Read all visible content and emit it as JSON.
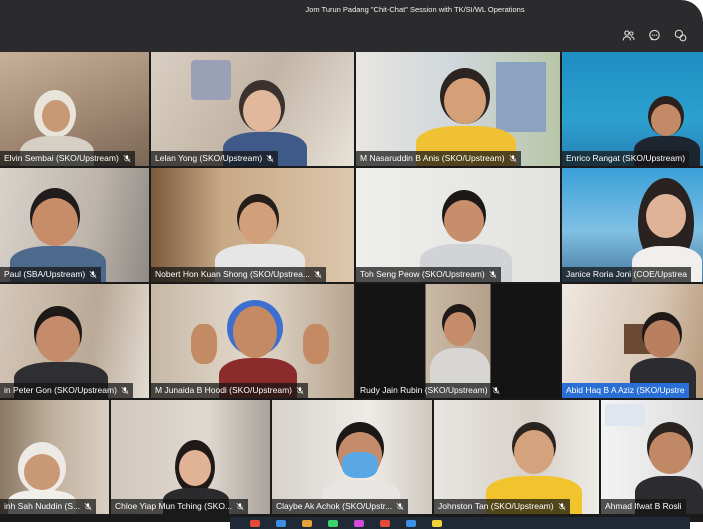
{
  "window": {
    "title": "Jom Turun Padang \"Chit-Chat\" Session with TK/SI/WL Operations"
  },
  "toolbar": {
    "icons": [
      "people-icon",
      "chat-icon",
      "reactions-icon",
      "more-icon"
    ]
  },
  "participants": [
    {
      "name": "Elvin Sembai (SKO/Upstream)",
      "row": 1
    },
    {
      "name": "Lelan Yong (SKO/Upstream)",
      "row": 1
    },
    {
      "name": "M Nasaruddin B Anis (SKO/Upstream)",
      "row": 1
    },
    {
      "name": "Enrico Rangat (SKO/Upstream)",
      "row": 1
    },
    {
      "name": "Paul (SBA/Upstream)",
      "row": 2
    },
    {
      "name": "Nobert Hon Kuan Shong (SKO/Upstrea...",
      "row": 2
    },
    {
      "name": "Toh Seng Peow (SKO/Upstream)",
      "row": 2
    },
    {
      "name": "Janice Roria Joni (COE/Upstrea",
      "row": 2
    },
    {
      "name": "in Peter Gon (SKO/Upstream)",
      "row": 3
    },
    {
      "name": "M Junaida B Hoodi (SKO/Upstream)",
      "row": 3
    },
    {
      "name": "Rudy Jain Rubin (SKO/Upstream)",
      "row": 3
    },
    {
      "name": "Abid Haq B A Aziz (SKO/Upstre",
      "row": 3,
      "highlighted": true
    },
    {
      "name": "inh Sah Nuddin (S...",
      "row": 4
    },
    {
      "name": "Chloe Yiap Mun Tching (SKO...",
      "row": 4
    },
    {
      "name": "Claybe Ak Achok (SKO/Upstr...",
      "row": 4
    },
    {
      "name": "Johnston Tan (SKO/Upstream)",
      "row": 4
    },
    {
      "name": "Ahmad Ifwat B Rosli",
      "row": 4
    }
  ],
  "colors": {
    "titlebar": "#2b2b2e",
    "highlight": "#2a6fd6"
  }
}
